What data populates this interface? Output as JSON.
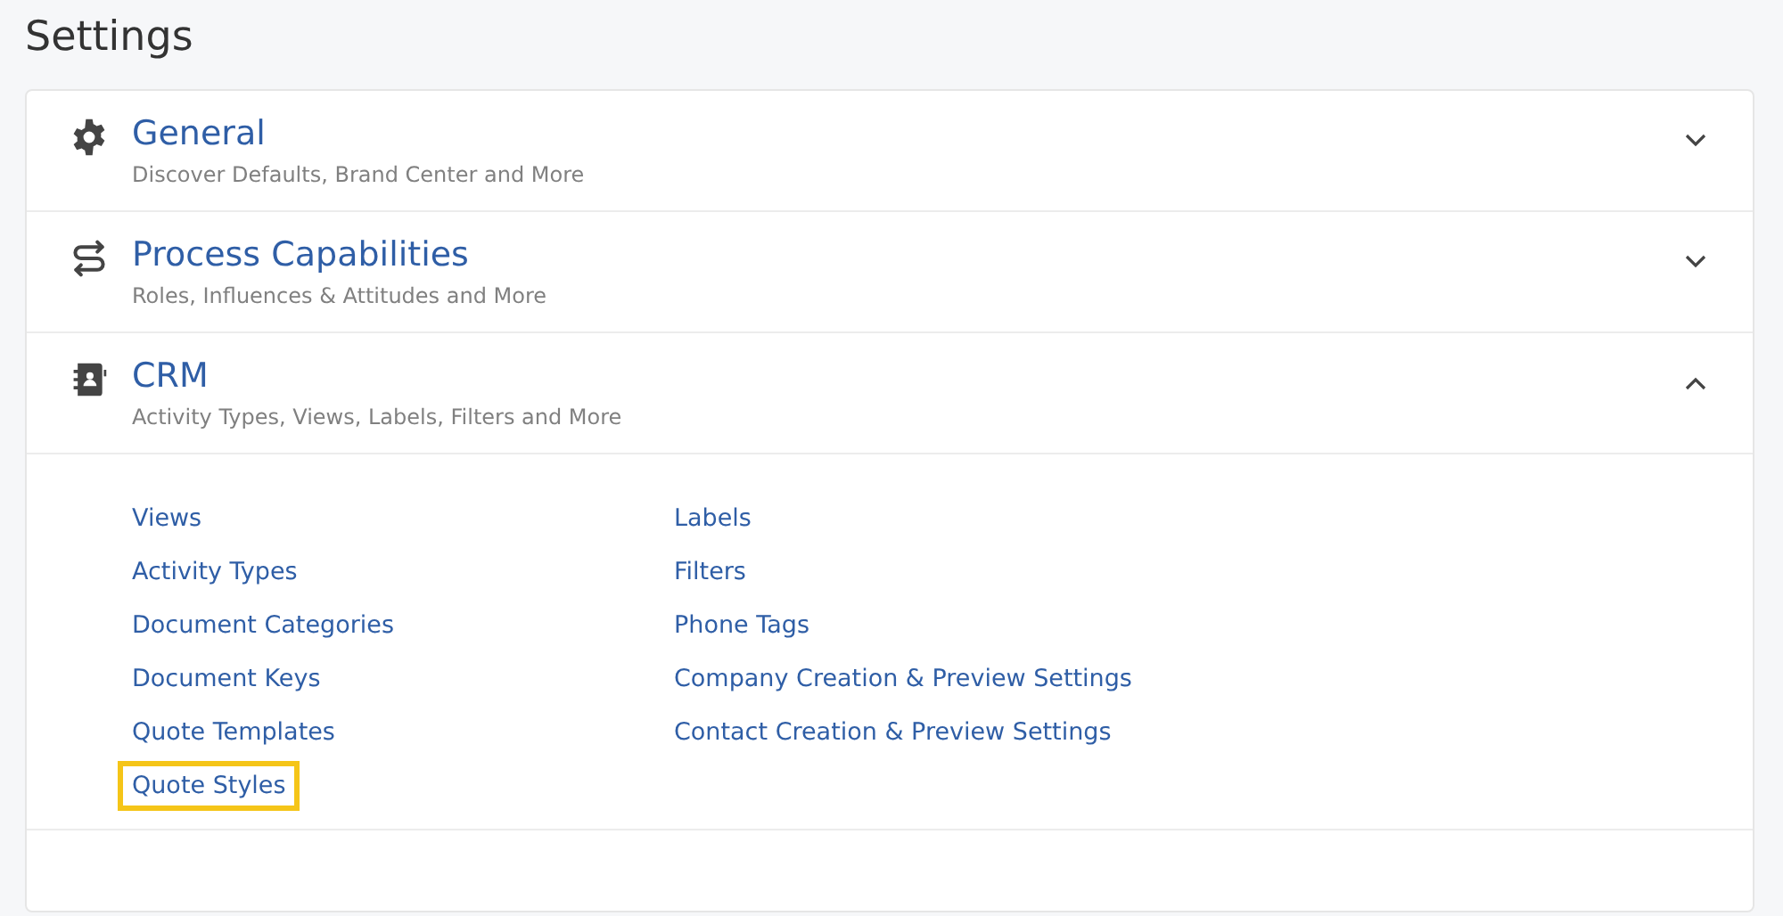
{
  "page_title": "Settings",
  "sections": [
    {
      "kind": "gear",
      "title": "General",
      "subtitle": "Discover Defaults, Brand Center and More",
      "expanded": false
    },
    {
      "kind": "process",
      "title": "Process Capabilities",
      "subtitle": "Roles, Influences & Attitudes and More",
      "expanded": false
    },
    {
      "kind": "contacts",
      "title": "CRM",
      "subtitle": "Activity Types, Views, Labels, Filters and More",
      "expanded": true,
      "link_columns": [
        [
          {
            "label": "Views",
            "highlighted": false
          },
          {
            "label": "Activity Types",
            "highlighted": false
          },
          {
            "label": "Document Categories",
            "highlighted": false
          },
          {
            "label": "Document Keys",
            "highlighted": false
          },
          {
            "label": "Quote Templates",
            "highlighted": false
          },
          {
            "label": "Quote Styles",
            "highlighted": true
          }
        ],
        [
          {
            "label": "Labels",
            "highlighted": false
          },
          {
            "label": "Filters",
            "highlighted": false
          },
          {
            "label": "Phone Tags",
            "highlighted": false
          },
          {
            "label": "Company Creation & Preview Settings",
            "highlighted": false
          },
          {
            "label": "Contact Creation & Preview Settings",
            "highlighted": false
          }
        ]
      ]
    }
  ]
}
